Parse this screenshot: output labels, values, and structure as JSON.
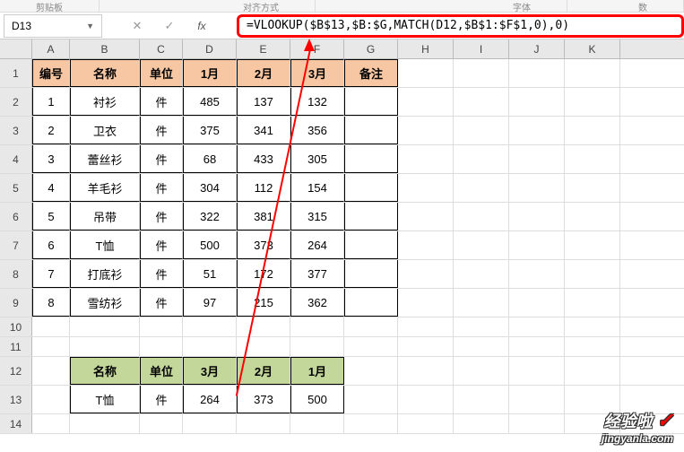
{
  "ribbon": {
    "item1": "剪贴板",
    "item2": "对齐方式",
    "item3": "字体",
    "item4": "数"
  },
  "name_box": {
    "value": "D13"
  },
  "formula": "=VLOOKUP($B$13,$B:$G,MATCH(D12,$B$1:$F$1,0),0)",
  "columns": [
    "A",
    "B",
    "C",
    "D",
    "E",
    "F",
    "G",
    "H",
    "I",
    "J",
    "K"
  ],
  "rows": [
    "1",
    "2",
    "3",
    "4",
    "5",
    "6",
    "7",
    "8",
    "9",
    "10",
    "11",
    "12",
    "13",
    "14"
  ],
  "table1": {
    "headers": [
      "编号",
      "名称",
      "单位",
      "1月",
      "2月",
      "3月",
      "备注"
    ],
    "data": [
      [
        "1",
        "衬衫",
        "件",
        "485",
        "137",
        "132",
        ""
      ],
      [
        "2",
        "卫衣",
        "件",
        "375",
        "341",
        "356",
        ""
      ],
      [
        "3",
        "蕾丝衫",
        "件",
        "68",
        "433",
        "305",
        ""
      ],
      [
        "4",
        "羊毛衫",
        "件",
        "304",
        "112",
        "154",
        ""
      ],
      [
        "5",
        "吊带",
        "件",
        "322",
        "381",
        "315",
        ""
      ],
      [
        "6",
        "T恤",
        "件",
        "500",
        "373",
        "264",
        ""
      ],
      [
        "7",
        "打底衫",
        "件",
        "51",
        "172",
        "377",
        ""
      ],
      [
        "8",
        "雪纺衫",
        "件",
        "97",
        "215",
        "362",
        ""
      ]
    ]
  },
  "table2": {
    "headers": [
      "名称",
      "单位",
      "3月",
      "2月",
      "1月"
    ],
    "data": [
      "T恤",
      "件",
      "264",
      "373",
      "500"
    ]
  },
  "watermark": {
    "line1": "经验啦",
    "line2": "jingyanla.com"
  },
  "chart_data": {
    "type": "table",
    "title": "",
    "tables": [
      {
        "headers": [
          "编号",
          "名称",
          "单位",
          "1月",
          "2月",
          "3月",
          "备注"
        ],
        "rows": [
          [
            1,
            "衬衫",
            "件",
            485,
            137,
            132,
            null
          ],
          [
            2,
            "卫衣",
            "件",
            375,
            341,
            356,
            null
          ],
          [
            3,
            "蕾丝衫",
            "件",
            68,
            433,
            305,
            null
          ],
          [
            4,
            "羊毛衫",
            "件",
            304,
            112,
            154,
            null
          ],
          [
            5,
            "吊带",
            "件",
            322,
            381,
            315,
            null
          ],
          [
            6,
            "T恤",
            "件",
            500,
            373,
            264,
            null
          ],
          [
            7,
            "打底衫",
            "件",
            51,
            172,
            377,
            null
          ],
          [
            8,
            "雪纺衫",
            "件",
            97,
            215,
            362,
            null
          ]
        ]
      },
      {
        "headers": [
          "名称",
          "单位",
          "3月",
          "2月",
          "1月"
        ],
        "rows": [
          [
            "T恤",
            "件",
            264,
            373,
            500
          ]
        ]
      }
    ]
  }
}
